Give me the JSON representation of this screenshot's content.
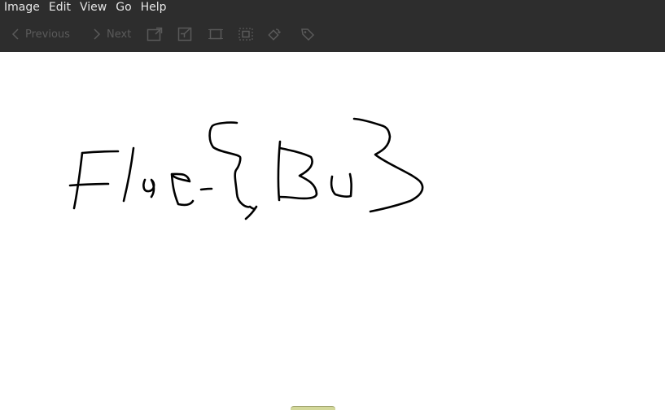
{
  "menubar": {
    "items": [
      "Image",
      "Edit",
      "View",
      "Go",
      "Help"
    ]
  },
  "toolbar": {
    "previous_label": "Previous",
    "next_label": "Next",
    "tools": [
      {
        "icon": "expand-icon"
      },
      {
        "icon": "shrink-icon"
      },
      {
        "icon": "fit-to-window-icon"
      },
      {
        "icon": "zoom-fill-icon"
      },
      {
        "icon": "rotate-icon"
      },
      {
        "icon": "tag-icon"
      }
    ]
  },
  "colors": {
    "toolbar_bg": "#2d2d2d",
    "menu_text": "#e6e6e6",
    "disabled_text": "#5a5a5a",
    "canvas_bg": "#ffffff",
    "ink": "#000000"
  },
  "image": {
    "handwritten_text": "Flag{Bu3"
  }
}
